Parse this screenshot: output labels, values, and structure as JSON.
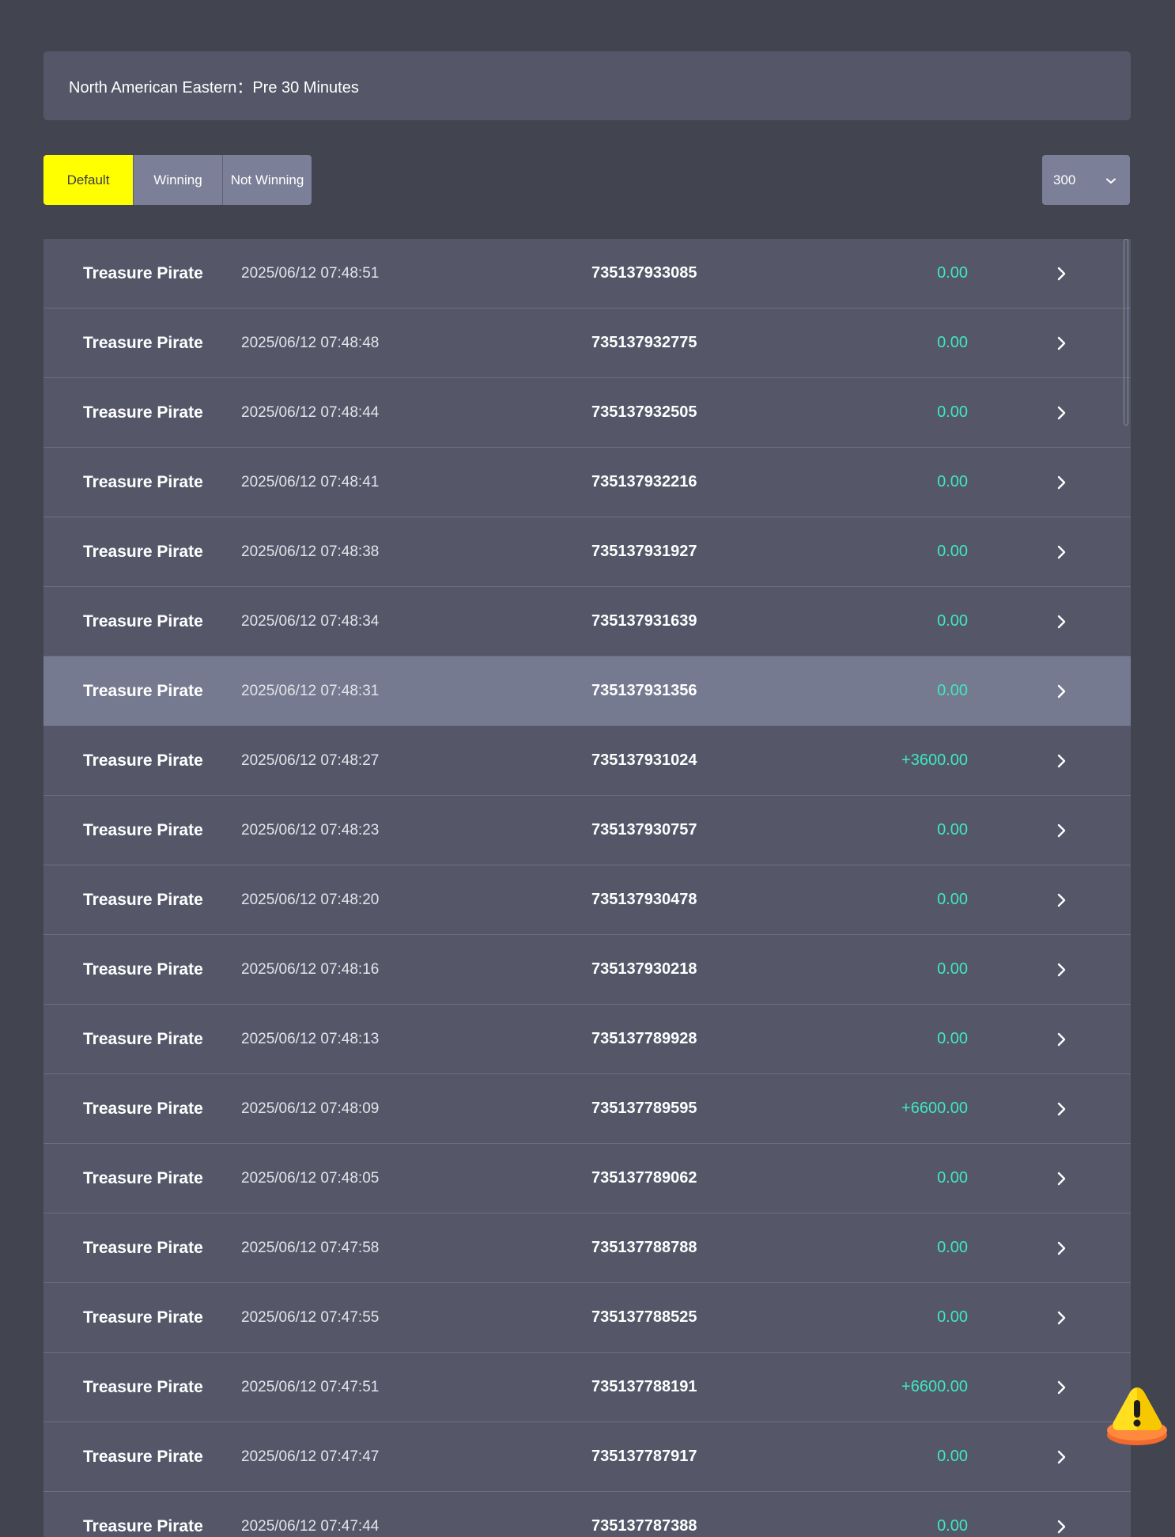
{
  "header": {
    "title": "North American Eastern：Pre 30 Minutes"
  },
  "filters": [
    {
      "label": "Default",
      "active": true
    },
    {
      "label": "Winning",
      "active": false
    },
    {
      "label": "Not Winning",
      "active": false
    }
  ],
  "page_size": {
    "value": "300"
  },
  "rows": [
    {
      "game": "Treasure Pirate",
      "time": "2025/06/12 07:48:51",
      "id": "735137933085",
      "amount": "0.00"
    },
    {
      "game": "Treasure Pirate",
      "time": "2025/06/12 07:48:48",
      "id": "735137932775",
      "amount": "0.00"
    },
    {
      "game": "Treasure Pirate",
      "time": "2025/06/12 07:48:44",
      "id": "735137932505",
      "amount": "0.00"
    },
    {
      "game": "Treasure Pirate",
      "time": "2025/06/12 07:48:41",
      "id": "735137932216",
      "amount": "0.00"
    },
    {
      "game": "Treasure Pirate",
      "time": "2025/06/12 07:48:38",
      "id": "735137931927",
      "amount": "0.00"
    },
    {
      "game": "Treasure Pirate",
      "time": "2025/06/12 07:48:34",
      "id": "735137931639",
      "amount": "0.00"
    },
    {
      "game": "Treasure Pirate",
      "time": "2025/06/12 07:48:31",
      "id": "735137931356",
      "amount": "0.00",
      "highlight": true
    },
    {
      "game": "Treasure Pirate",
      "time": "2025/06/12 07:48:27",
      "id": "735137931024",
      "amount": "+3600.00"
    },
    {
      "game": "Treasure Pirate",
      "time": "2025/06/12 07:48:23",
      "id": "735137930757",
      "amount": "0.00"
    },
    {
      "game": "Treasure Pirate",
      "time": "2025/06/12 07:48:20",
      "id": "735137930478",
      "amount": "0.00"
    },
    {
      "game": "Treasure Pirate",
      "time": "2025/06/12 07:48:16",
      "id": "735137930218",
      "amount": "0.00"
    },
    {
      "game": "Treasure Pirate",
      "time": "2025/06/12 07:48:13",
      "id": "735137789928",
      "amount": "0.00"
    },
    {
      "game": "Treasure Pirate",
      "time": "2025/06/12 07:48:09",
      "id": "735137789595",
      "amount": "+6600.00"
    },
    {
      "game": "Treasure Pirate",
      "time": "2025/06/12 07:48:05",
      "id": "735137789062",
      "amount": "0.00"
    },
    {
      "game": "Treasure Pirate",
      "time": "2025/06/12 07:47:58",
      "id": "735137788788",
      "amount": "0.00"
    },
    {
      "game": "Treasure Pirate",
      "time": "2025/06/12 07:47:55",
      "id": "735137788525",
      "amount": "0.00"
    },
    {
      "game": "Treasure Pirate",
      "time": "2025/06/12 07:47:51",
      "id": "735137788191",
      "amount": "+6600.00"
    },
    {
      "game": "Treasure Pirate",
      "time": "2025/06/12 07:47:47",
      "id": "735137787917",
      "amount": "0.00"
    },
    {
      "game": "Treasure Pirate",
      "time": "2025/06/12 07:47:44",
      "id": "735137787388",
      "amount": "0.00"
    }
  ],
  "icons": {
    "row_action": "chevron-right-icon",
    "dropdown": "chevron-down-icon",
    "floating": "warning-icon"
  },
  "colors": {
    "active_filter": "#ffff00",
    "amount": "#3ee8c0",
    "row_bg": "#555769",
    "row_highlight": "#767a90"
  }
}
